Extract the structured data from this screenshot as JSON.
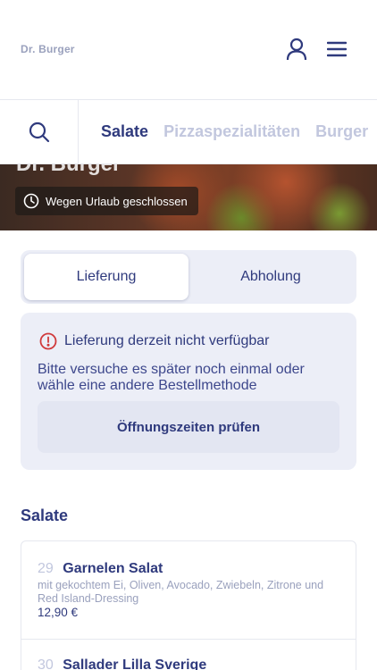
{
  "header": {
    "brand": "Dr. Burger",
    "user_icon": "user-icon",
    "menu_icon": "hamburger-menu-icon"
  },
  "categories": {
    "search_icon": "search-icon",
    "items": [
      "Salate",
      "Pizzaspezialitäten",
      "Burger"
    ],
    "active": "Salate"
  },
  "hero": {
    "title": "Dr. Burger",
    "status_icon": "clock-icon",
    "status": "Wegen Urlaub geschlossen"
  },
  "order_mode": {
    "delivery": "Lieferung",
    "pickup": "Abholung",
    "selected": "Lieferung"
  },
  "notice": {
    "icon": "alert-circle-icon",
    "title": "Lieferung derzeit nicht verfügbar",
    "text": "Bitte versuche es später noch einmal oder wähle eine andere Bestellmethode",
    "button": "Öffnungszeiten prüfen"
  },
  "section": {
    "title": "Salate"
  },
  "menu_items": [
    {
      "number": "29",
      "name": "Garnelen Salat",
      "description": "mit gekochtem Ei, Oliven, Avocado, Zwiebeln, Zitrone und Red Island-Dressing",
      "price": "12,90 €"
    },
    {
      "number": "30",
      "name": "Sallader Lilla Sverige",
      "description": "",
      "price": ""
    }
  ],
  "colors": {
    "primary": "#2f3a7d",
    "muted": "#c2c7de",
    "panel": "#eceef7",
    "alert": "#d0393b"
  }
}
